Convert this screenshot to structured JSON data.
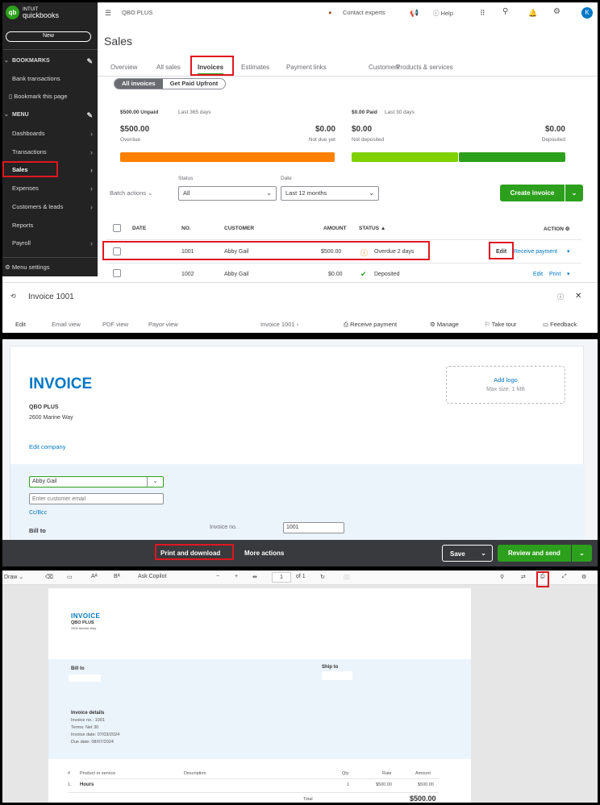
{
  "sidebar": {
    "logo_brand": "INTUIT",
    "logo_product": "quickbooks",
    "new_label": "New",
    "bookmarks_heading": "BOOKMARKS",
    "bookmark_items": [
      "Bank transactions",
      "Bookmark this page"
    ],
    "menu_heading": "MENU",
    "menu_items": [
      {
        "label": "Dashboards"
      },
      {
        "label": "Transactions"
      },
      {
        "label": "Sales"
      },
      {
        "label": "Expenses"
      },
      {
        "label": "Customers & leads"
      },
      {
        "label": "Reports"
      },
      {
        "label": "Payroll"
      }
    ],
    "menu_settings": "Menu settings"
  },
  "topbar": {
    "company": "QBO PLUS",
    "contact_experts": "Contact experts",
    "help": "Help",
    "avatar_initial": "K"
  },
  "page": {
    "title": "Sales",
    "tabs": [
      "Overview",
      "All sales",
      "Invoices",
      "Estimates",
      "Payment links",
      "Customers",
      "Products & services"
    ],
    "segments": [
      "All invoices",
      "Get Paid Upfront"
    ]
  },
  "summary": {
    "unpaid_label": "$500.00 Unpaid",
    "unpaid_period": "Last 365 days",
    "overdue_amount": "$500.00",
    "overdue_label": "Overdue",
    "not_due_amount": "$0.00",
    "not_due_label": "Not due yet",
    "paid_label": "$0.00 Paid",
    "paid_period": "Last 30 days",
    "not_deposited_amount": "$0.00",
    "not_deposited_label": "Not deposited",
    "deposited_amount": "$0.00",
    "deposited_label": "Deposited",
    "colors": {
      "overdue": "#ff8000",
      "not_deposited": "#7fd000",
      "deposited": "#2ca01c"
    }
  },
  "filters": {
    "batch_actions": "Batch actions",
    "status_label": "Status",
    "status_value": "All",
    "date_label": "Date",
    "date_value": "Last 12 months",
    "create_invoice": "Create invoice"
  },
  "table": {
    "headers": [
      "DATE",
      "NO.",
      "CUSTOMER",
      "AMOUNT",
      "STATUS ▲",
      "ACTION"
    ],
    "rows": [
      {
        "date": "",
        "no": "1001",
        "customer": "Abby Gail",
        "amount": "$500.00",
        "status": "Overdue 2 days",
        "actions": [
          "Edit",
          "Receive payment"
        ]
      },
      {
        "date": "",
        "no": "1002",
        "customer": "Abby Gail",
        "amount": "$0.00",
        "status": "Deposited",
        "actions": [
          "Edit",
          "Print"
        ]
      }
    ]
  },
  "drawer": {
    "title": "Invoice 1001",
    "views": [
      "Edit",
      "Email view",
      "PDF view",
      "Payor view"
    ],
    "breadcrumb": "Invoice 1001",
    "actions": [
      "Receive payment",
      "Manage",
      "Take tour",
      "Feedback"
    ]
  },
  "invoice_form": {
    "heading": "INVOICE",
    "company_name": "QBO PLUS",
    "company_address": "2600 Marine Way",
    "edit_company": "Edit company",
    "add_logo": "Add logo",
    "max_size": "Max size: 1 MB",
    "customer": "Abby Gail",
    "email_placeholder": "Enter customer email",
    "cc_bcc": "Cc/Bcc",
    "bill_to": "Bill to",
    "invoice_no_label": "Invoice no.",
    "invoice_no": "1001",
    "footer": {
      "print_download": "Print and download",
      "more_actions": "More actions",
      "save": "Save",
      "review_send": "Review and send"
    }
  },
  "pdf_viewer": {
    "toolbar": {
      "draw": "Draw",
      "ask_copilot": "Ask Copilot",
      "page": "1",
      "of_pages": "of 1"
    },
    "sheet": {
      "heading": "INVOICE",
      "company_name": "QBO PLUS",
      "company_address": "2600 Marine Way",
      "bill_to": "Bill to",
      "ship_to": "Ship to",
      "details_heading": "Invoice details",
      "details": [
        "Invoice no.: 1001",
        "Terms: Net 30",
        "Invoice date: 07/03/2024",
        "Due date: 08/07/2024"
      ],
      "columns": [
        "#",
        "Product or service",
        "Description",
        "Qty",
        "Rate",
        "Amount"
      ],
      "lines": [
        {
          "n": "1.",
          "product": "Hours",
          "description": "",
          "qty": "1",
          "rate": "$500.00",
          "amount": "$500.00"
        }
      ],
      "total_label": "Total",
      "total": "$500.00"
    }
  }
}
